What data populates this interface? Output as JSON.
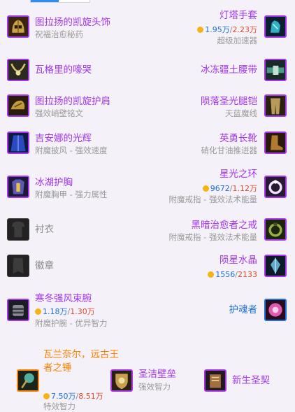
{
  "left": [
    {
      "name": "图拉扬的凯旋头饰",
      "sub": "祝福治愈秘药",
      "quality": "epic",
      "icon": "helmet-icon"
    },
    {
      "name": "瓦格里的嚎哭",
      "sub": "",
      "quality": "epic",
      "icon": "necklace-icon"
    },
    {
      "name": "图拉扬的凯旋护肩",
      "sub": "强效峭壁铭文",
      "quality": "epic",
      "icon": "shoulder-icon"
    },
    {
      "name": "吉安娜的光辉",
      "sub": "附魔披风 - 强效速度",
      "quality": "epic",
      "icon": "cloak-icon"
    },
    {
      "name": "冰湖护胸",
      "sub": "附魔胸甲 - 强力属性",
      "quality": "epic",
      "icon": "chest-icon"
    },
    {
      "name": "衬衣",
      "sub": "",
      "quality": "empty",
      "icon": "shirt-slot-icon"
    },
    {
      "name": "徽章",
      "sub": "",
      "quality": "empty",
      "icon": "tabard-slot-icon"
    },
    {
      "name": "寒冬强风束腕",
      "sub": "附魔护腕 - 优异智力",
      "quality": "epic",
      "icon": "bracer-icon",
      "price_a": "1.18万",
      "price_b": "1.30万"
    }
  ],
  "right": [
    {
      "name": "灯塔手套",
      "sub": "超级加速器",
      "quality": "epic",
      "icon": "gloves-icon",
      "price_a": "1.95万",
      "price_b": "2.23万"
    },
    {
      "name": "冰冻疆土腰带",
      "sub": "",
      "quality": "epic",
      "icon": "belt-icon"
    },
    {
      "name": "陨落圣光腿铠",
      "sub": "天蓝魔线",
      "quality": "epic",
      "icon": "legs-icon"
    },
    {
      "name": "英勇长靴",
      "sub": "硝化甘油推进器",
      "quality": "epic",
      "icon": "boots-icon"
    },
    {
      "name": "星光之环",
      "sub": "附魔戒指 - 强效法术能量",
      "quality": "epic",
      "icon": "ring-icon",
      "price_a": "9672",
      "price_b": "1.12万"
    },
    {
      "name": "黑暗治愈者之戒",
      "sub": "附魔戒指 - 强效法术能量",
      "quality": "epic",
      "icon": "ring-icon-2"
    },
    {
      "name": "陨星水晶",
      "sub": "",
      "quality": "epic",
      "icon": "crystal-icon",
      "price_a": "1556",
      "price_b": "2133"
    },
    {
      "name": "护魂者",
      "sub": "",
      "quality": "rare",
      "icon": "orb-icon"
    }
  ],
  "weapons": [
    {
      "name": "瓦兰奈尔，远古王者之锤",
      "sub": "特效智力",
      "quality": "legendary",
      "icon": "mace-icon",
      "price_a": "7.50万",
      "price_b": "8.51万"
    },
    {
      "name": "圣洁壁垒",
      "sub": "强效智力",
      "quality": "epic",
      "icon": "shield-icon"
    },
    {
      "name": "新生圣契",
      "sub": "",
      "quality": "epic",
      "icon": "libram-icon"
    }
  ],
  "colors": {
    "epic": "#a335ee",
    "rare": "#1e6fe0",
    "legendary": "#ff8000",
    "background": "#f4f2f8"
  }
}
